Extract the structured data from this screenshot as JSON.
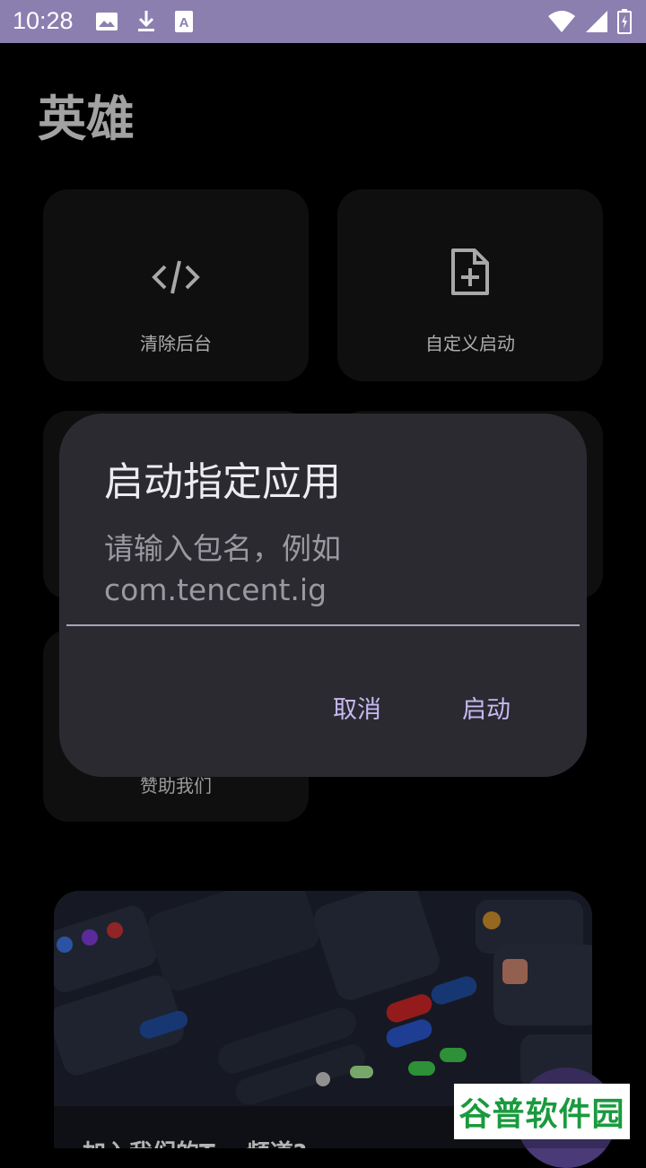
{
  "statusbar": {
    "time": "10:28",
    "left_icons": [
      "image-icon",
      "download-icon",
      "font-icon"
    ],
    "right_icons": [
      "wifi-icon",
      "signal-icon",
      "battery-icon"
    ],
    "color": "#8b7fb0"
  },
  "page": {
    "title": "英雄"
  },
  "cards": [
    {
      "label": "清除后台",
      "icon": "code-icon"
    },
    {
      "label": "自定义启动",
      "icon": "file-plus-icon"
    },
    {
      "label": "赞助我们",
      "icon": ""
    }
  ],
  "dialog": {
    "title": "启动指定应用",
    "placeholder": "请输入包名，例如 com.tencent.ig",
    "placeholder_line1": "请输入包名，例如",
    "placeholder_line2": "com.tencent.ig",
    "cancel_label": "取消",
    "confirm_label": "启动",
    "accent": "#c7b9f2"
  },
  "promo": {
    "text": "加入我们的T… 频道?"
  },
  "watermark": {
    "text": "谷普软件园"
  }
}
